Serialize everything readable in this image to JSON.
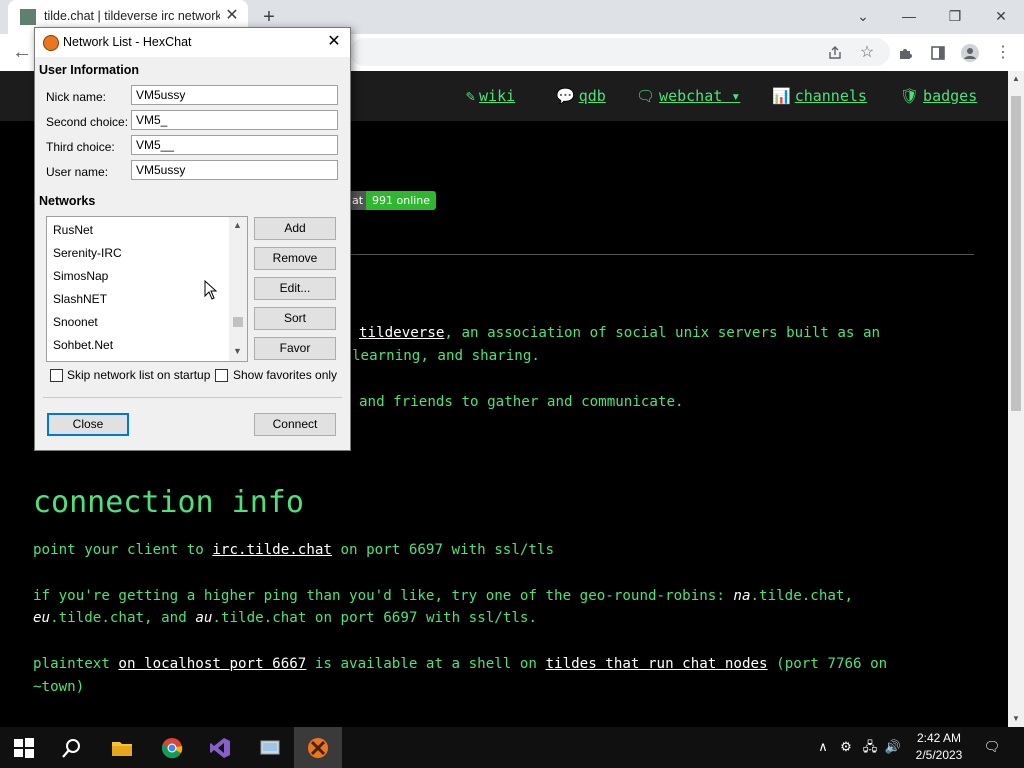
{
  "browser": {
    "tab_title": "tilde.chat | tildeverse irc network",
    "tab_close": "✕",
    "new_tab": "+",
    "back": "←",
    "window_controls": {
      "minimize": "—",
      "restore": "❐",
      "close": "✕",
      "dropdown": "⌄"
    }
  },
  "nav": {
    "wiki": "wiki",
    "qdb": "qdb",
    "webchat": "webchat",
    "channels": "channels",
    "badges": "badges"
  },
  "page": {
    "badge_left": "at",
    "badge_right": "991 online",
    "para1_tail_link": "tildeverse",
    "para1_tail_text": ", an association of social unix servers built as an",
    "para1_line2": "learning, and sharing.",
    "para2_line": "and friends to gather and communicate.",
    "connection_heading": "connection info",
    "point_pre": "point your client to ",
    "point_link": "irc.tilde.chat",
    "point_post": " on port 6697 with ssl/tls",
    "ping_pre": "if you're getting a higher ping than you'd like, try one of the geo-round-robins: ",
    "ping_na": "na",
    "ping_na_post": ".tilde.chat,",
    "ping_eu": "eu",
    "ping_eu_post": ".tilde.chat, and ",
    "ping_au": "au",
    "ping_au_post": ".tilde.chat on port 6697 with ssl/tls.",
    "plain_pre": "plaintext ",
    "plain_link1": "on localhost port 6667",
    "plain_mid": " is available at a shell on ",
    "plain_link2": "tildes that run chat nodes",
    "plain_post": " (port 7766 on",
    "plain_line2": "~town)"
  },
  "dialog": {
    "title": "Network List - HexChat",
    "close_glyph": "✕",
    "user_info_heading": "User Information",
    "nick_label": "Nick name:",
    "nick_value": "VM5ussy",
    "second_label": "Second choice:",
    "second_value": "VM5_",
    "third_label": "Third choice:",
    "third_value": "VM5__",
    "user_label": "User name:",
    "user_value": "VM5ussy",
    "networks_heading": "Networks",
    "networks": [
      "RusNet",
      "Serenity-IRC",
      "SimosNap",
      "SlashNET",
      "Snoonet",
      "Sohbet.Net"
    ],
    "buttons": {
      "add": "Add",
      "remove": "Remove",
      "edit": "Edit...",
      "sort": "Sort",
      "favor": "Favor"
    },
    "skip_label": "Skip network list on startup",
    "skip_checked": false,
    "favorites_label": "Show favorites only",
    "favorites_checked": false,
    "close_button": "Close",
    "connect_button": "Connect"
  },
  "taskbar": {
    "time": "2:42 AM",
    "date": "2/5/2023"
  },
  "colors": {
    "accent_green": "#4be27a",
    "online_green": "#2fb72f",
    "focus_blue": "#0078d7"
  }
}
